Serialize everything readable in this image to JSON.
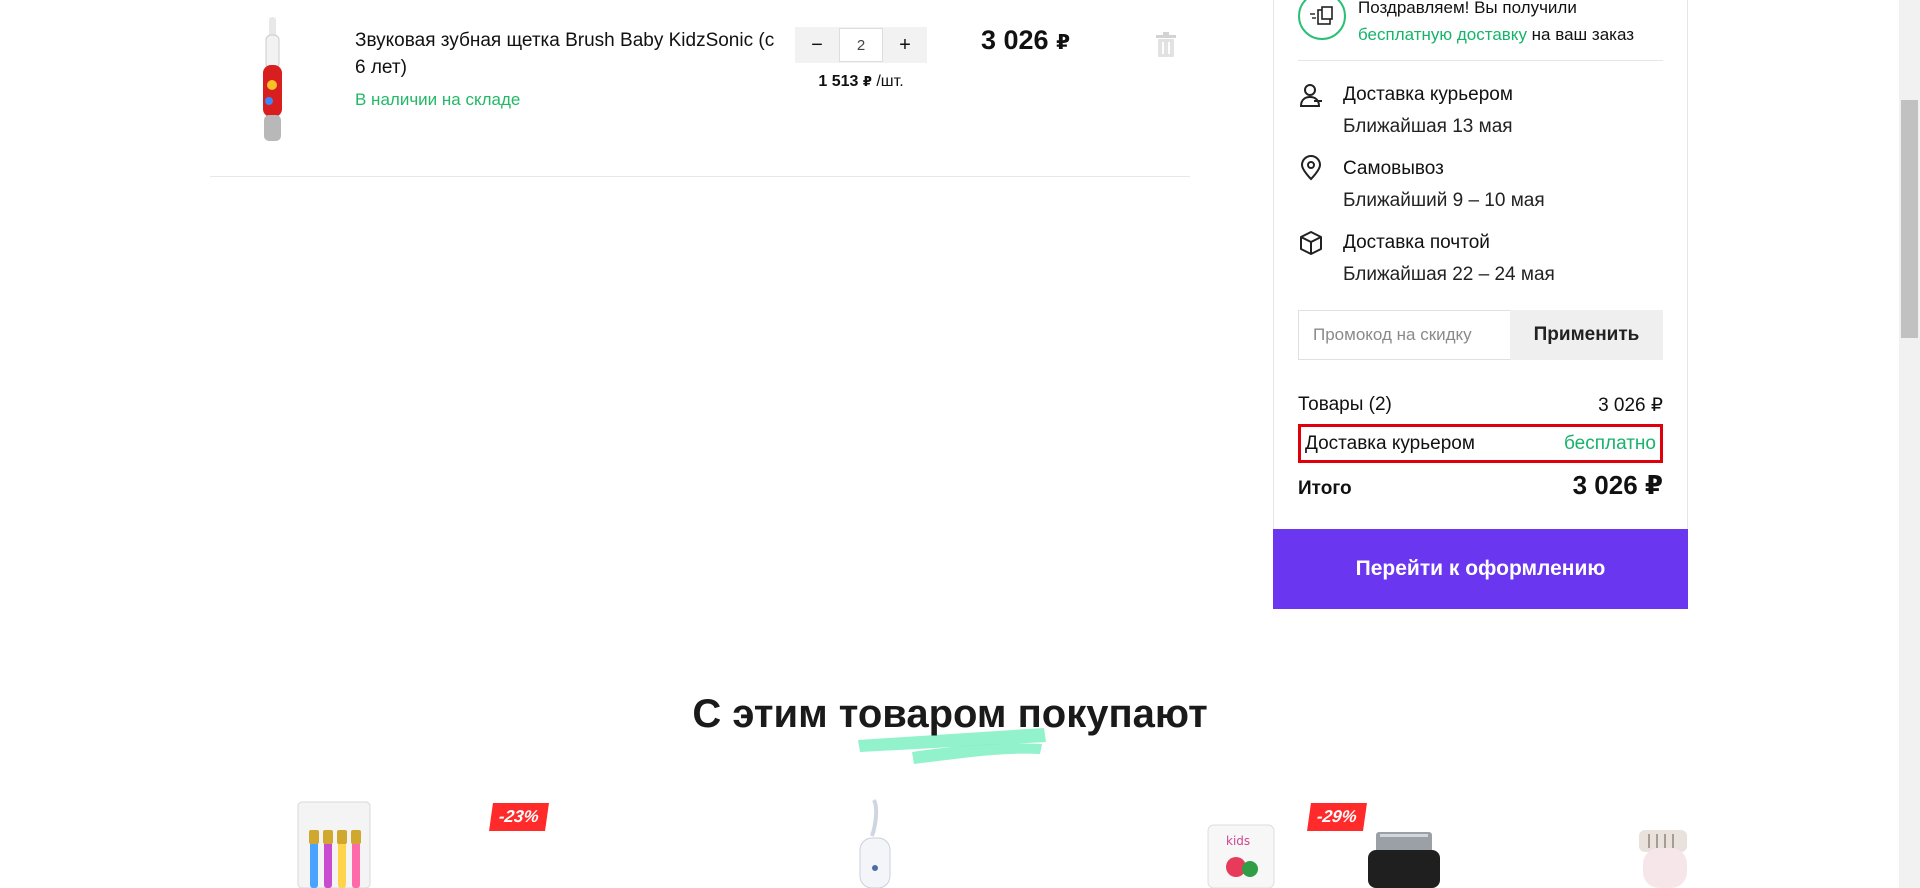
{
  "cart_item": {
    "title": "Звуковая зубная щетка Brush Baby KidzSonic (с 6 лет)",
    "stock_status": "В наличии на складе",
    "qty_decrement": "−",
    "qty_value": "2",
    "qty_increment": "+",
    "unit_price": "1 513",
    "unit_currency": "₽",
    "unit_suffix": "/шт.",
    "line_total": "3 026",
    "line_currency": "₽"
  },
  "summary": {
    "congrats_prefix": "Поздравляем! Вы получили",
    "congrats_highlight": "бесплатную доставку",
    "congrats_suffix": "на ваш заказ",
    "delivery_options": [
      {
        "title": "Доставка курьером",
        "subtitle": "Ближайшая 13 мая",
        "icon": "courier-icon"
      },
      {
        "title": "Самовывоз",
        "subtitle": "Ближайший 9 – 10 мая",
        "icon": "map-pin-icon"
      },
      {
        "title": "Доставка почтой",
        "subtitle": "Ближайшая 22 – 24 мая",
        "icon": "box-icon"
      }
    ],
    "promo_placeholder": "Промокод на скидку",
    "promo_apply": "Применить",
    "items_label": "Товары (2)",
    "items_value": "3 026 ₽",
    "delivery_label": "Доставка курьером",
    "delivery_value": "бесплатно",
    "total_label": "Итого",
    "total_value": "3 026 ₽",
    "checkout": "Перейти к оформлению"
  },
  "recommendations": {
    "title": "С этим товаром покупают",
    "badges": [
      "-23%",
      "-29%"
    ]
  },
  "colors": {
    "accent_green": "#16b36a",
    "checkout_purple": "#6a36f0",
    "highlight_red": "#e0000a",
    "badge_red": "#ff2a2a"
  }
}
